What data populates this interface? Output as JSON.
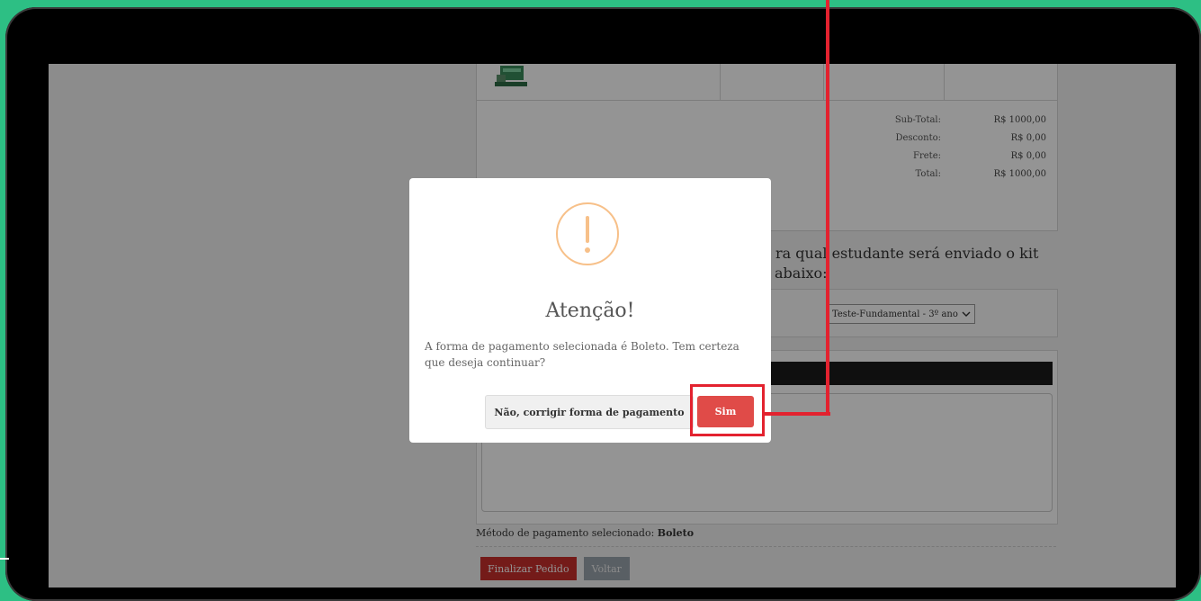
{
  "cart": {
    "totals": [
      {
        "label": "Sub-Total:",
        "value": "R$ 1000,00"
      },
      {
        "label": "Desconto:",
        "value": "R$ 0,00"
      },
      {
        "label": "Frete:",
        "value": "R$ 0,00"
      },
      {
        "label": "Total:",
        "value": "R$ 1000,00"
      }
    ]
  },
  "student": {
    "heading_line1": "ra qual estudante será enviado o kit",
    "heading_line2": "abaixo:",
    "selected": "Teste-Fundamental - 3º ano",
    "chevron": "chevron-down-icon"
  },
  "payment": {
    "method_label": "Método de pagamento selecionado:",
    "method_value": "Boleto",
    "finalize_label": "Finalizar Pedido",
    "back_label": "Voltar"
  },
  "modal": {
    "icon": "warning-icon",
    "title": "Atenção!",
    "message": "A forma de pagamento selecionada é Boleto. Tem certeza que deseja continuar?",
    "cancel_label": "Não, corrigir forma de pagamento",
    "confirm_label": "Sim"
  },
  "colors": {
    "background": "#2dbf84",
    "confirm": "#e04b48",
    "highlight": "#e3222f",
    "warning": "#f7c089"
  }
}
